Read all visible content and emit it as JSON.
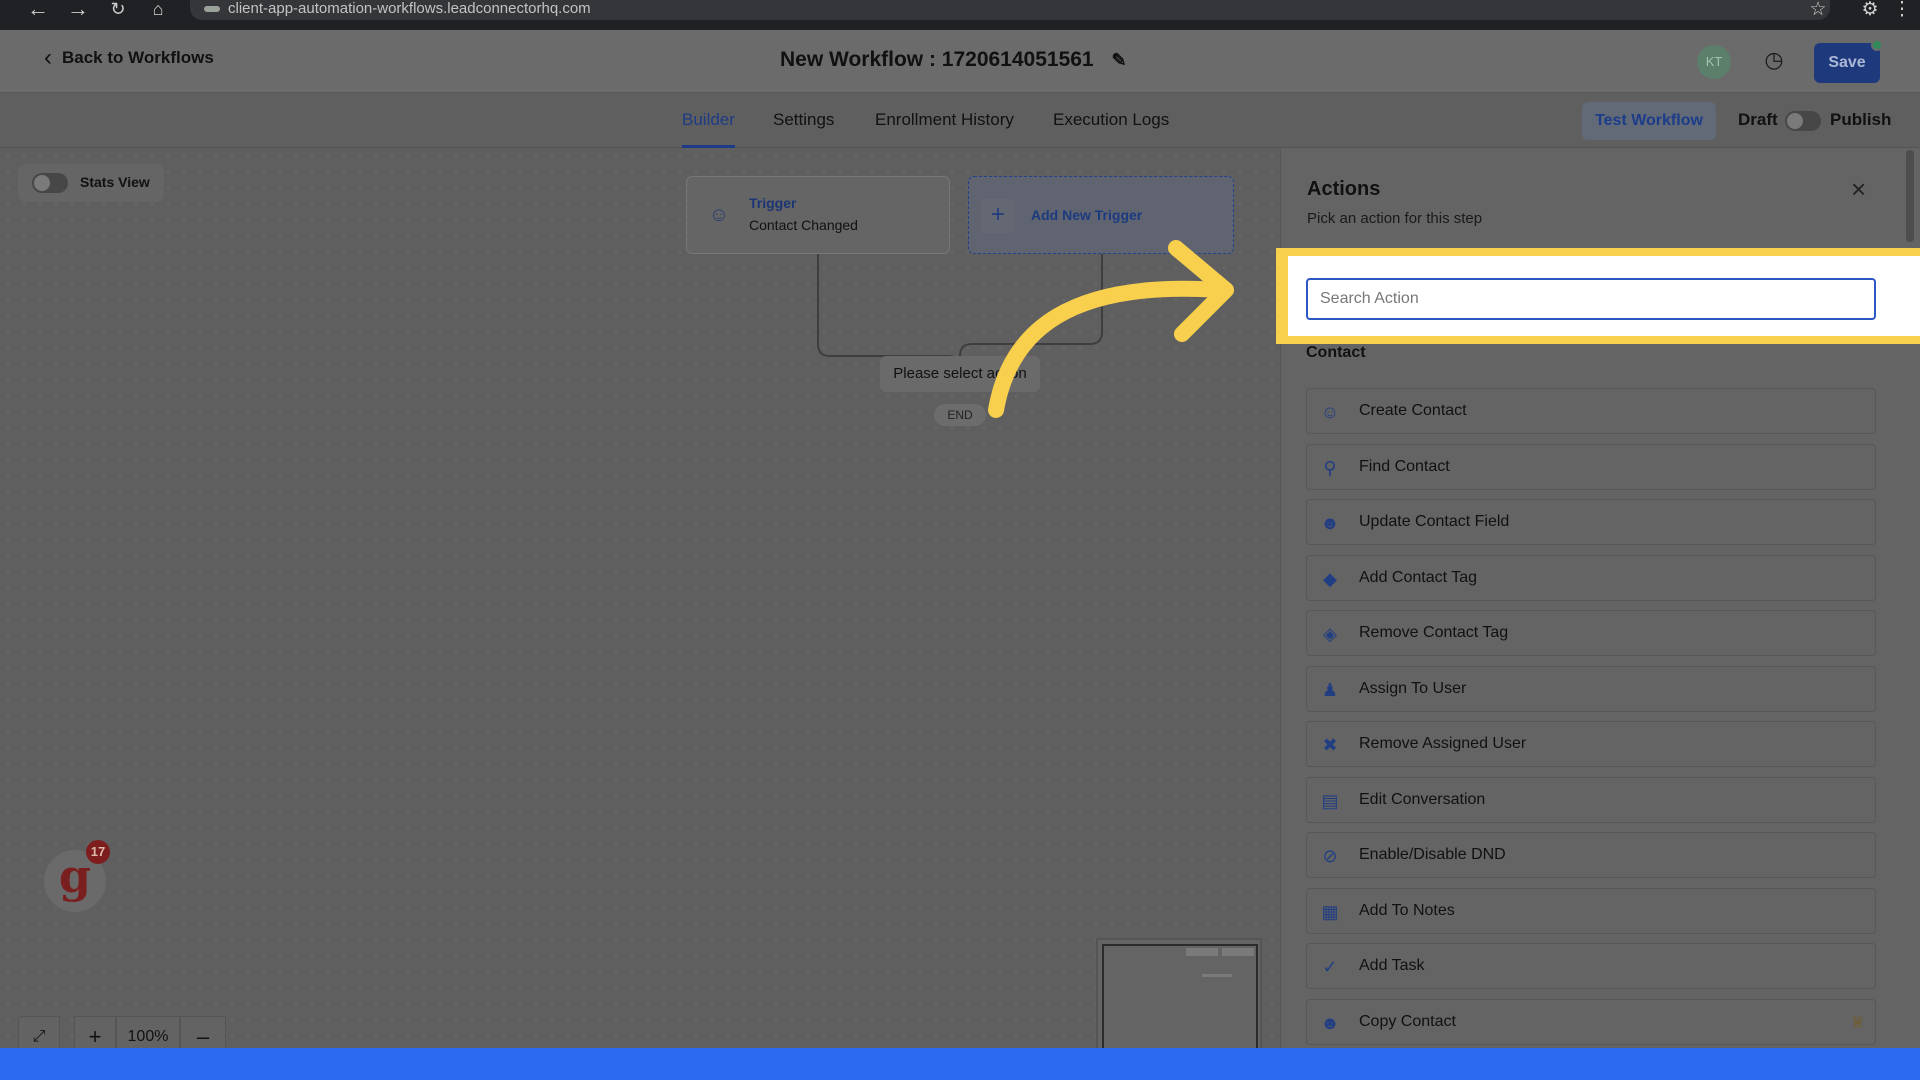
{
  "browser": {
    "url": "client-app-automation-workflows.leadconnectorhq.com"
  },
  "header": {
    "back_label": "Back to Workflows",
    "title": "New Workflow : 1720614051561",
    "avatar_initials": "KT",
    "save_label": "Save"
  },
  "tabs": [
    {
      "label": "Builder",
      "active": true
    },
    {
      "label": "Settings",
      "active": false
    },
    {
      "label": "Enrollment History",
      "active": false
    },
    {
      "label": "Execution Logs",
      "active": false
    }
  ],
  "toolbar": {
    "test_workflow_label": "Test Workflow",
    "draft_label": "Draft",
    "publish_label": "Publish"
  },
  "canvas": {
    "stats_view_label": "Stats View",
    "trigger_title": "Trigger",
    "trigger_subtitle": "Contact Changed",
    "add_trigger_label": "Add New Trigger",
    "select_action_label": "Please select action",
    "end_label": "END",
    "zoom_level": "100%",
    "notification_count": "17"
  },
  "panel": {
    "title": "Actions",
    "subtitle": "Pick an action for this step",
    "search_placeholder": "Search Action",
    "section_label": "Contact",
    "items": [
      {
        "label": "Create Contact",
        "icon": "create-contact-icon",
        "premium": false
      },
      {
        "label": "Find Contact",
        "icon": "find-contact-icon",
        "premium": false
      },
      {
        "label": "Update Contact Field",
        "icon": "update-contact-icon",
        "premium": false
      },
      {
        "label": "Add Contact Tag",
        "icon": "tag-icon",
        "premium": false
      },
      {
        "label": "Remove Contact Tag",
        "icon": "remove-tag-icon",
        "premium": false
      },
      {
        "label": "Assign To User",
        "icon": "assign-user-icon",
        "premium": false
      },
      {
        "label": "Remove Assigned User",
        "icon": "remove-user-icon",
        "premium": false
      },
      {
        "label": "Edit Conversation",
        "icon": "conversation-icon",
        "premium": false
      },
      {
        "label": "Enable/Disable DND",
        "icon": "dnd-icon",
        "premium": false
      },
      {
        "label": "Add To Notes",
        "icon": "notes-icon",
        "premium": false
      },
      {
        "label": "Add Task",
        "icon": "task-icon",
        "premium": false
      },
      {
        "label": "Copy Contact",
        "icon": "copy-contact-icon",
        "premium": true
      }
    ]
  },
  "colors": {
    "accent": "#2b58c4",
    "highlight": "#f9d04d",
    "bottom_bar": "#2c6bef"
  }
}
